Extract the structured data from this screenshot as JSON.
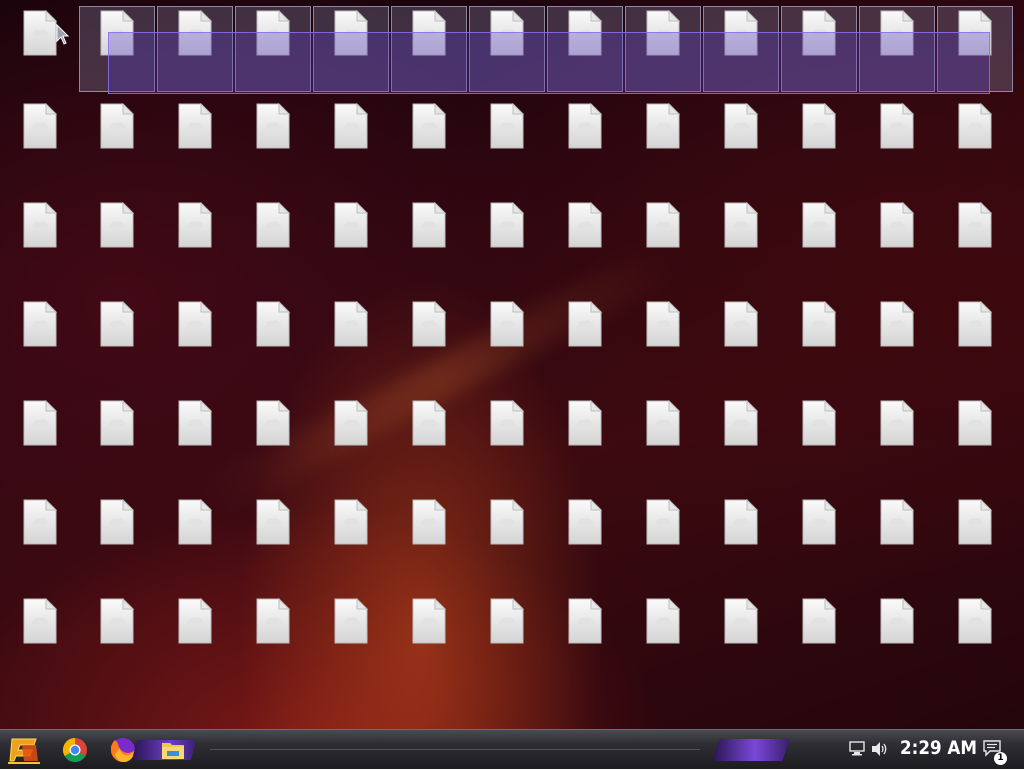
{
  "desktop": {
    "selection_color": "#6a40c8",
    "icons": [
      {
        "caption": ""
      },
      {
        "caption": ""
      },
      {
        "caption": ""
      },
      {
        "caption": ""
      },
      {
        "caption": ""
      },
      {
        "caption": ""
      },
      {
        "caption": ""
      },
      {
        "caption": ""
      },
      {
        "caption": ""
      },
      {
        "caption": ""
      },
      {
        "caption": ""
      },
      {
        "caption": ""
      },
      {
        "caption": ""
      },
      {
        "caption": ""
      },
      {
        "caption": ""
      },
      {
        "caption": ""
      },
      {
        "caption": ""
      },
      {
        "caption": ""
      },
      {
        "caption": ""
      },
      {
        "caption": ""
      },
      {
        "caption": ""
      },
      {
        "caption": ""
      },
      {
        "caption": ""
      },
      {
        "caption": ""
      },
      {
        "caption": ""
      },
      {
        "caption": ""
      },
      {
        "caption": ""
      },
      {
        "caption": ""
      },
      {
        "caption": ""
      },
      {
        "caption": ""
      },
      {
        "caption": ""
      },
      {
        "caption": ""
      },
      {
        "caption": ""
      },
      {
        "caption": ""
      },
      {
        "caption": ""
      },
      {
        "caption": ""
      },
      {
        "caption": ""
      },
      {
        "caption": ""
      },
      {
        "caption": ""
      },
      {
        "caption": ""
      },
      {
        "caption": ""
      },
      {
        "caption": ""
      },
      {
        "caption": ""
      },
      {
        "caption": ""
      },
      {
        "caption": ""
      },
      {
        "caption": ""
      },
      {
        "caption": ""
      },
      {
        "caption": ""
      },
      {
        "caption": ""
      },
      {
        "caption": ""
      },
      {
        "caption": ""
      },
      {
        "caption": ""
      },
      {
        "caption": ""
      },
      {
        "caption": ""
      },
      {
        "caption": ""
      },
      {
        "caption": ""
      },
      {
        "caption": ""
      },
      {
        "caption": ""
      },
      {
        "caption": ""
      },
      {
        "caption": ""
      },
      {
        "caption": ""
      },
      {
        "caption": ""
      },
      {
        "caption": ""
      },
      {
        "caption": ""
      },
      {
        "caption": ""
      },
      {
        "caption": ""
      },
      {
        "caption": ""
      },
      {
        "caption": ""
      },
      {
        "caption": ""
      },
      {
        "caption": ""
      },
      {
        "caption": ""
      },
      {
        "caption": ""
      },
      {
        "caption": ""
      },
      {
        "caption": ""
      },
      {
        "caption": ""
      },
      {
        "caption": ""
      },
      {
        "caption": ""
      },
      {
        "caption": ""
      },
      {
        "caption": ""
      },
      {
        "caption": ""
      },
      {
        "caption": ""
      },
      {
        "caption": ""
      },
      {
        "caption": ""
      },
      {
        "caption": ""
      },
      {
        "caption": ""
      },
      {
        "caption": ""
      },
      {
        "caption": ""
      },
      {
        "caption": ""
      },
      {
        "caption": ""
      },
      {
        "caption": ""
      },
      {
        "caption": ""
      }
    ]
  },
  "taskbar": {
    "start_icon": "start-logo-icon",
    "pinned": [
      {
        "name": "chrome-icon"
      },
      {
        "name": "firefox-icon"
      },
      {
        "name": "file-explorer-icon"
      }
    ],
    "accent_color": "#6a40c8"
  },
  "tray": {
    "network_icon": "network-icon",
    "volume_icon": "volume-icon",
    "clock": "2:29 AM",
    "notification_count": "1"
  }
}
